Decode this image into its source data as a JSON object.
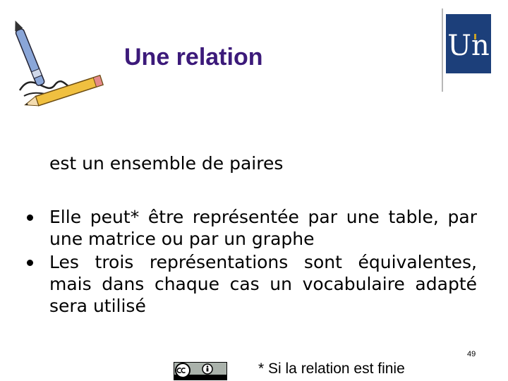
{
  "slide": {
    "title": "Une relation",
    "intro": "est un ensemble de paires",
    "bullets": [
      "Elle peut* être représentée par une table, par une matrice ou par un graphe",
      "Les trois représentations sont équivalentes, mais dans chaque cas un vocabulaire adapté sera utilisé"
    ],
    "page_number": "49",
    "footnote": "* Si la relation est finie",
    "logo_text": "Un"
  },
  "colors": {
    "title": "#3c1a7a",
    "logo_background": "#1c3f7a",
    "logo_accent": "#c9a227"
  },
  "icons": [
    "pen-and-pencil-clipart",
    "university-logo",
    "creative-commons-by-badge"
  ]
}
